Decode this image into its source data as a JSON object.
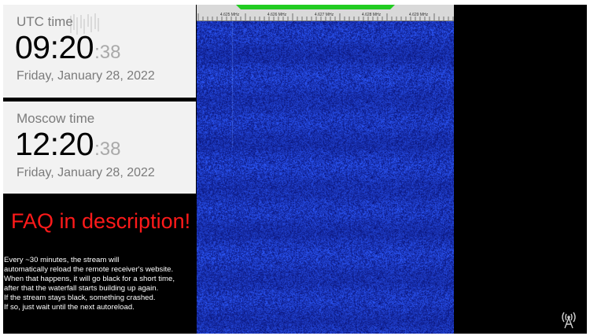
{
  "utc_clock": {
    "label": "UTC time",
    "hours_minutes": "09:20",
    "seconds": ":38",
    "date": "Friday, January 28, 2022"
  },
  "moscow_clock": {
    "label": "Moscow time",
    "hours_minutes": "12:20",
    "seconds": ":38",
    "date": "Friday, January 28, 2022"
  },
  "faq_banner": "FAQ in description!",
  "notice_lines": [
    "Every ~30 minutes, the stream will",
    "automatically reload the remote receiver's website.",
    "When that happens, it will go black for a short time,",
    "after that the waterfall starts building up again.",
    "If the stream stays black, something crashed.",
    "If so, just wait until the next autoreload."
  ],
  "waterfall": {
    "frequency_labels": [
      "4.625 MHz",
      "4.626 MHz",
      "4.627 MHz",
      "4.628 MHz",
      "4.629 MHz"
    ],
    "passband_color": "#22cc22",
    "background_color": "#1a2db0"
  },
  "colors": {
    "faq_red": "#ff1a1a",
    "clock_panel_bg": "#f2f2f2"
  },
  "icons": {
    "watermark": "radio-tower-logo-icon"
  }
}
